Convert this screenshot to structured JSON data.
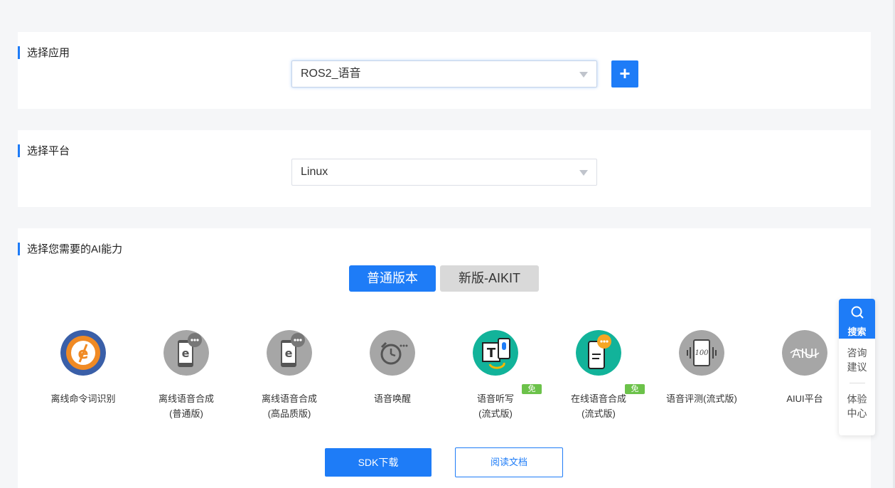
{
  "app_section": {
    "title": "选择应用",
    "selected": "ROS2_语音",
    "add_label": "+"
  },
  "platform_section": {
    "title": "选择平台",
    "selected": "Linux"
  },
  "ability_section": {
    "title": "选择您需要的AI能力",
    "tabs": [
      {
        "label": "普通版本"
      },
      {
        "label": "新版-AIKIT"
      }
    ],
    "capabilities": [
      {
        "line1": "离线命令词识别",
        "line2": ""
      },
      {
        "line1": "离线语音合成",
        "line2": "(普通版)"
      },
      {
        "line1": "离线语音合成",
        "line2": "(高品质版)"
      },
      {
        "line1": "语音唤醒",
        "line2": ""
      },
      {
        "line1": "语音听写",
        "line2": "(流式版)",
        "badge": "免费"
      },
      {
        "line1": "在线语音合成",
        "line2": "(流式版)",
        "badge": "免费"
      },
      {
        "line1": "语音评测(流式版)",
        "line2": ""
      },
      {
        "line1": "AIUI平台",
        "line2": ""
      }
    ],
    "sdk_button": "SDK下载",
    "docs_button": "阅读文档"
  },
  "float_panel": {
    "search": "搜索",
    "consult": [
      "咨询",
      "建议"
    ],
    "experience": [
      "体验",
      "中心"
    ]
  },
  "colors": {
    "accent": "#1e7cf7",
    "free_badge": "#6cc24a",
    "teal": "#12b39a",
    "gray_icon": "#a6a6a6"
  }
}
